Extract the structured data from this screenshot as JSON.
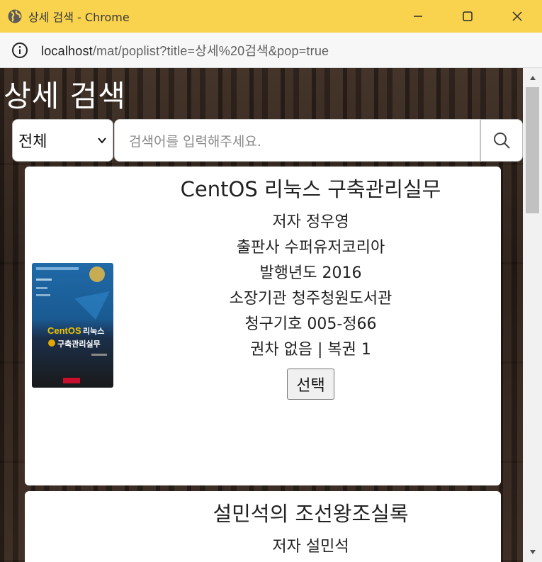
{
  "window": {
    "title": "상세 검색 - Chrome"
  },
  "address_bar": {
    "url_host": "localhost",
    "url_path": "/mat/poplist?title=상세%20검색&pop=true"
  },
  "page": {
    "title": "상세 검색",
    "search": {
      "category_selected": "전체",
      "placeholder": "검색어를 입력해주세요."
    },
    "results": [
      {
        "title": "CentOS 리눅스 구축관리실무",
        "author": "저자 정우영",
        "publisher": "출판사 수퍼유저코리아",
        "year": "발행년도 2016",
        "library": "소장기관 청주청원도서관",
        "call_number": "청구기호 005-정66",
        "volume": "권차 없음 | 복권 1",
        "select_label": "선택",
        "cover_text": "CentOS리눅스 구축관리실무"
      },
      {
        "title": "설민석의 조선왕조실록",
        "author": "저자 설민석"
      }
    ]
  },
  "colors": {
    "titlebar": "#f9d34e",
    "card_bg": "#ffffff",
    "scrollbar_thumb": "#c1c1c1"
  }
}
